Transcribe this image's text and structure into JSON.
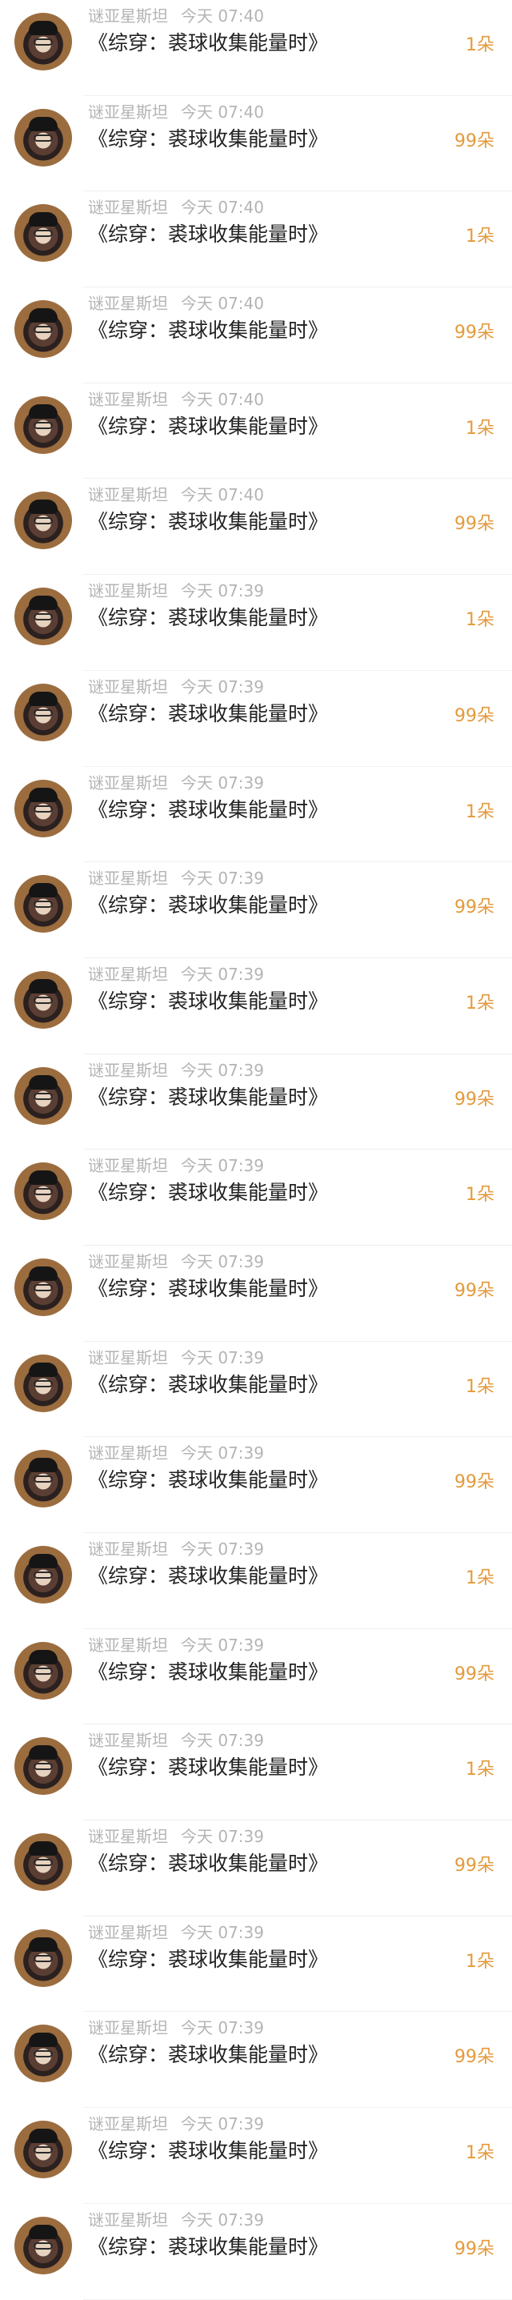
{
  "items": [
    {
      "user": "谜亚星斯坦",
      "time": "今天 07:40",
      "title": "《综穿：裘球收集能量时》",
      "count": "1朵"
    },
    {
      "user": "谜亚星斯坦",
      "time": "今天 07:40",
      "title": "《综穿：裘球收集能量时》",
      "count": "99朵"
    },
    {
      "user": "谜亚星斯坦",
      "time": "今天 07:40",
      "title": "《综穿：裘球收集能量时》",
      "count": "1朵"
    },
    {
      "user": "谜亚星斯坦",
      "time": "今天 07:40",
      "title": "《综穿：裘球收集能量时》",
      "count": "99朵"
    },
    {
      "user": "谜亚星斯坦",
      "time": "今天 07:40",
      "title": "《综穿：裘球收集能量时》",
      "count": "1朵"
    },
    {
      "user": "谜亚星斯坦",
      "time": "今天 07:40",
      "title": "《综穿：裘球收集能量时》",
      "count": "99朵"
    },
    {
      "user": "谜亚星斯坦",
      "time": "今天 07:39",
      "title": "《综穿：裘球收集能量时》",
      "count": "1朵"
    },
    {
      "user": "谜亚星斯坦",
      "time": "今天 07:39",
      "title": "《综穿：裘球收集能量时》",
      "count": "99朵"
    },
    {
      "user": "谜亚星斯坦",
      "time": "今天 07:39",
      "title": "《综穿：裘球收集能量时》",
      "count": "1朵"
    },
    {
      "user": "谜亚星斯坦",
      "time": "今天 07:39",
      "title": "《综穿：裘球收集能量时》",
      "count": "99朵"
    },
    {
      "user": "谜亚星斯坦",
      "time": "今天 07:39",
      "title": "《综穿：裘球收集能量时》",
      "count": "1朵"
    },
    {
      "user": "谜亚星斯坦",
      "time": "今天 07:39",
      "title": "《综穿：裘球收集能量时》",
      "count": "99朵"
    },
    {
      "user": "谜亚星斯坦",
      "time": "今天 07:39",
      "title": "《综穿：裘球收集能量时》",
      "count": "1朵"
    },
    {
      "user": "谜亚星斯坦",
      "time": "今天 07:39",
      "title": "《综穿：裘球收集能量时》",
      "count": "99朵"
    },
    {
      "user": "谜亚星斯坦",
      "time": "今天 07:39",
      "title": "《综穿：裘球收集能量时》",
      "count": "1朵"
    },
    {
      "user": "谜亚星斯坦",
      "time": "今天 07:39",
      "title": "《综穿：裘球收集能量时》",
      "count": "99朵"
    },
    {
      "user": "谜亚星斯坦",
      "time": "今天 07:39",
      "title": "《综穿：裘球收集能量时》",
      "count": "1朵"
    },
    {
      "user": "谜亚星斯坦",
      "time": "今天 07:39",
      "title": "《综穿：裘球收集能量时》",
      "count": "99朵"
    },
    {
      "user": "谜亚星斯坦",
      "time": "今天 07:39",
      "title": "《综穿：裘球收集能量时》",
      "count": "1朵"
    },
    {
      "user": "谜亚星斯坦",
      "time": "今天 07:39",
      "title": "《综穿：裘球收集能量时》",
      "count": "99朵"
    },
    {
      "user": "谜亚星斯坦",
      "time": "今天 07:39",
      "title": "《综穿：裘球收集能量时》",
      "count": "1朵"
    },
    {
      "user": "谜亚星斯坦",
      "time": "今天 07:39",
      "title": "《综穿：裘球收集能量时》",
      "count": "99朵"
    },
    {
      "user": "谜亚星斯坦",
      "time": "今天 07:39",
      "title": "《综穿：裘球收集能量时》",
      "count": "1朵"
    },
    {
      "user": "谜亚星斯坦",
      "time": "今天 07:39",
      "title": "《综穿：裘球收集能量时》",
      "count": "99朵"
    }
  ]
}
